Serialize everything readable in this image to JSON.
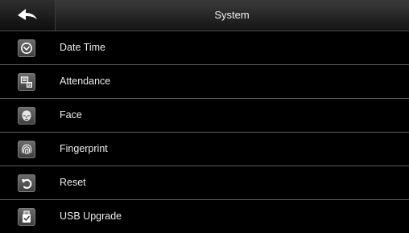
{
  "header": {
    "title": "System",
    "back_icon": "back-arrow-icon"
  },
  "menu": {
    "items": [
      {
        "label": "Date Time",
        "icon": "clock-icon"
      },
      {
        "label": "Attendance",
        "icon": "attendance-icon"
      },
      {
        "label": "Face",
        "icon": "face-icon"
      },
      {
        "label": "Fingerprint",
        "icon": "fingerprint-icon"
      },
      {
        "label": "Reset",
        "icon": "reset-icon"
      },
      {
        "label": "USB Upgrade",
        "icon": "usb-upgrade-icon"
      }
    ]
  }
}
